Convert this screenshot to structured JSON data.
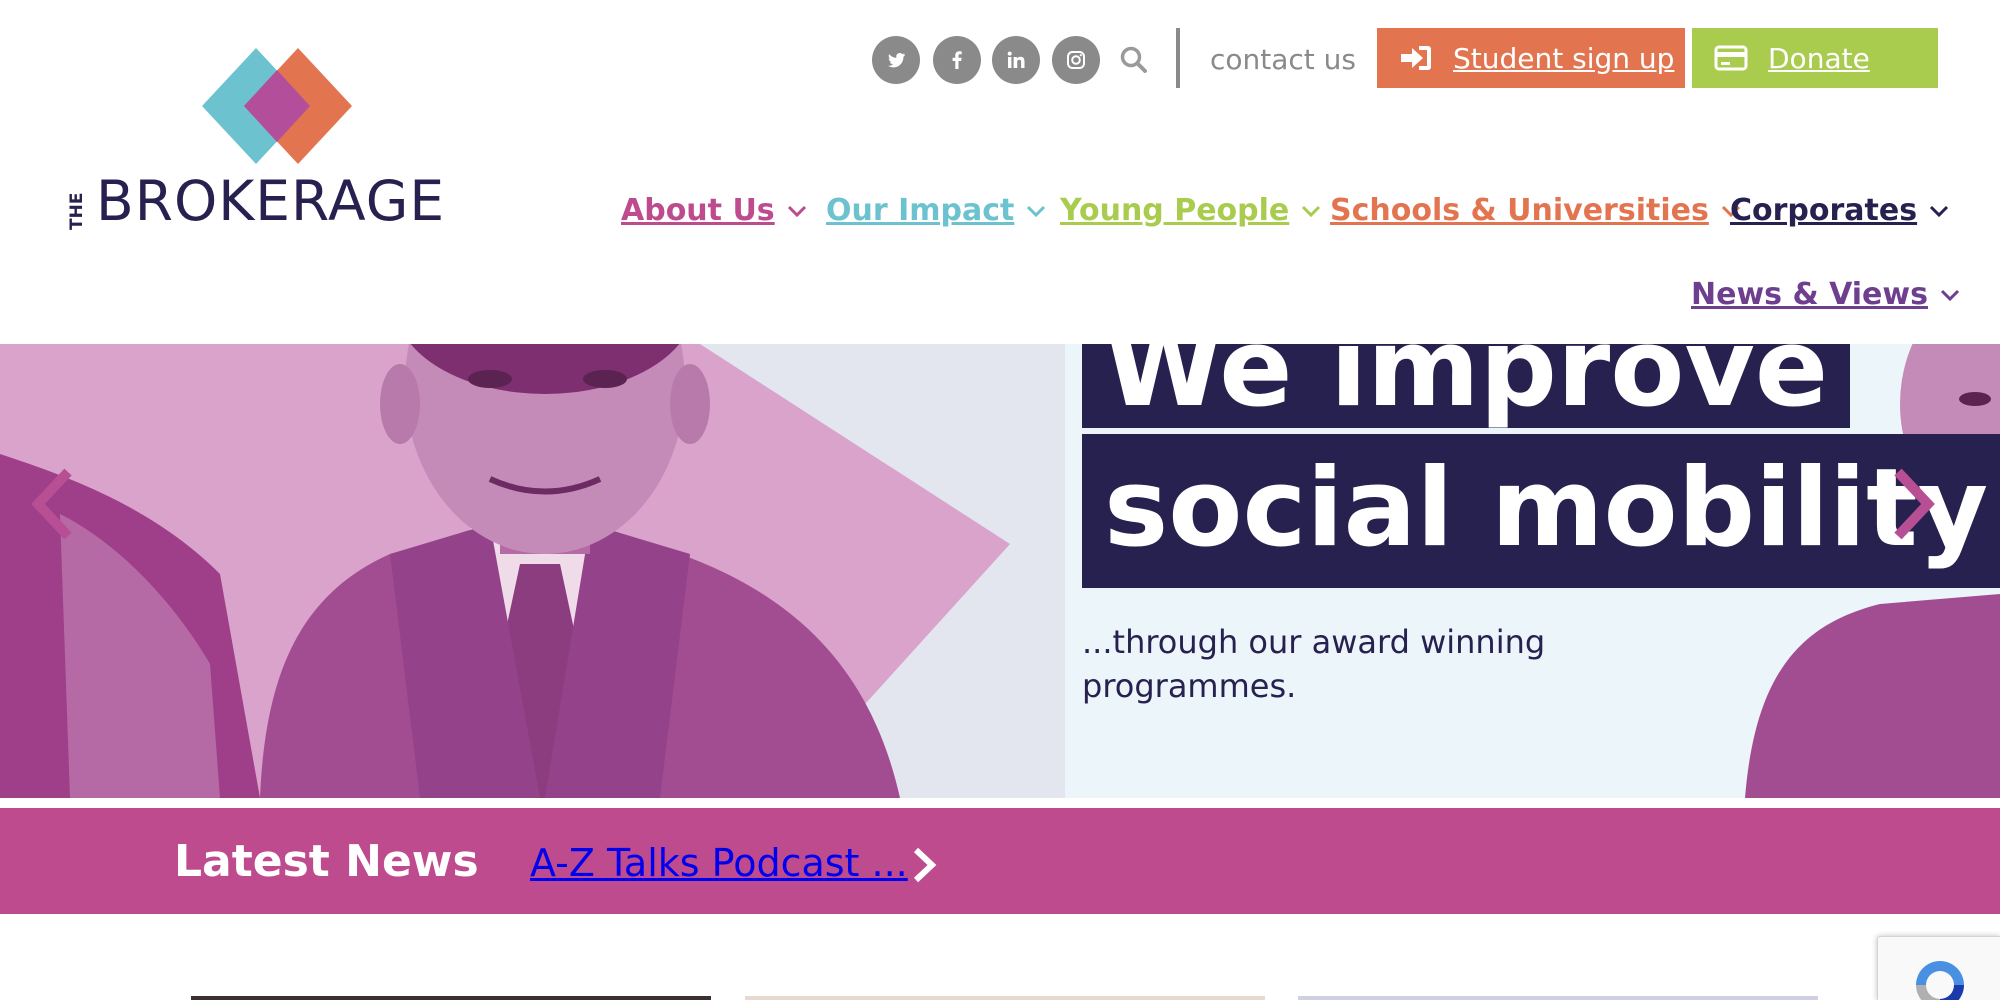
{
  "brand": {
    "logo_alt": "THE BROKERAGE",
    "wordmark": "BROKERAGE",
    "prefix": "THE",
    "colors": {
      "navy": "#27214f",
      "teal": "#6cc3cf",
      "orange": "#e27550",
      "magenta": "#bd4b8e",
      "green": "#a9cb4e",
      "purple": "#6f3f8f"
    }
  },
  "topbar": {
    "social": [
      {
        "name": "twitter",
        "icon": "twitter-icon"
      },
      {
        "name": "facebook",
        "icon": "facebook-icon"
      },
      {
        "name": "linkedin",
        "icon": "linkedin-icon"
      },
      {
        "name": "instagram",
        "icon": "instagram-icon"
      }
    ],
    "search_icon": "search-icon",
    "contact_label": "contact us",
    "student_signup_label": "Student sign up",
    "student_signup_icon": "sign-in-icon",
    "donate_label": "Donate",
    "donate_icon": "credit-card-icon"
  },
  "nav": {
    "items": [
      {
        "label": "About Us",
        "color": "#bd4b8e"
      },
      {
        "label": "Our Impact",
        "color": "#6cc3cf"
      },
      {
        "label": "Young People",
        "color": "#a9cb4e"
      },
      {
        "label": "Schools & Universities",
        "color": "#e27550"
      },
      {
        "label": "Corporates",
        "color": "#27214f"
      },
      {
        "label": "News & Views",
        "color": "#6f3f8f"
      }
    ]
  },
  "hero": {
    "headline_line1": "We improve",
    "headline_line2": "social mobility",
    "subtext": "...through our award winning programmes."
  },
  "latest_news": {
    "title": "Latest News",
    "item": "A-Z Talks Podcast ..."
  }
}
